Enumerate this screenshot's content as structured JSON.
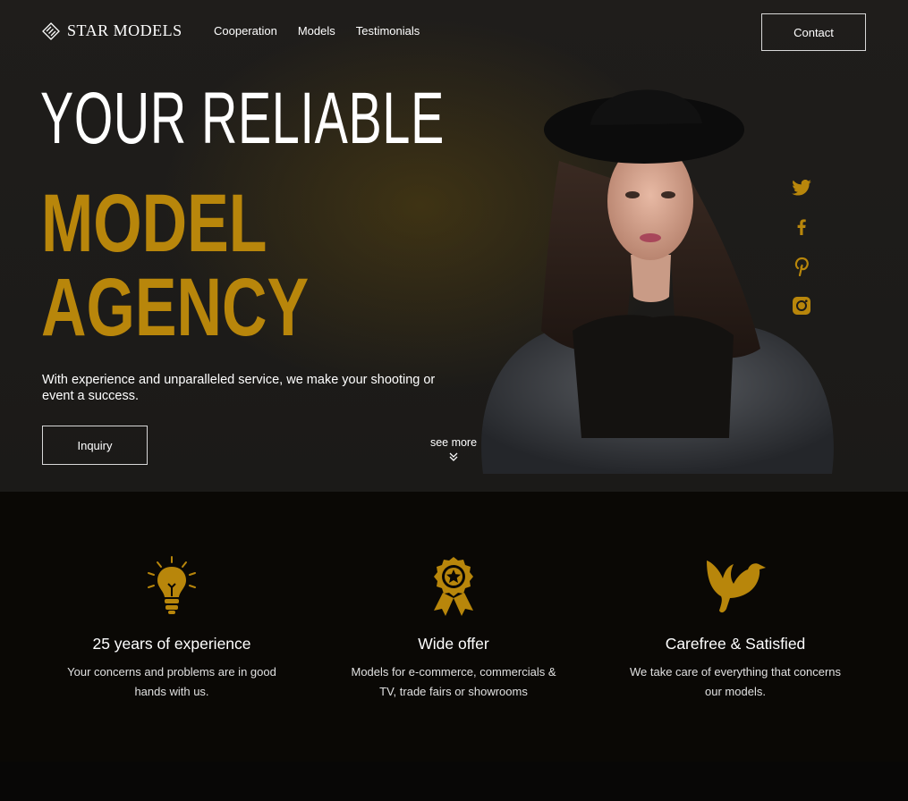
{
  "brand": {
    "name": "STAR MODELS",
    "accent": "#b8860b"
  },
  "nav": {
    "items": [
      "Cooperation",
      "Models",
      "Testimonials"
    ]
  },
  "header": {
    "contact_label": "Contact"
  },
  "hero": {
    "line1": "YOUR RELIABLE",
    "line2": "MODEL",
    "line3": "AGENCY",
    "subtitle": "With experience and unparalleled service, we make your shooting or event a success.",
    "inquiry_label": "Inquiry",
    "see_more_label": "see more"
  },
  "social": [
    "twitter-icon",
    "facebook-icon",
    "pinterest-icon",
    "instagram-icon"
  ],
  "features": [
    {
      "icon": "lightbulb-icon",
      "title": "25 years of experience",
      "text": "Your concerns and problems are in good hands with us."
    },
    {
      "icon": "award-badge-icon",
      "title": "Wide offer",
      "text": "Models for e-commerce, commercials & TV, trade fairs or showrooms"
    },
    {
      "icon": "dove-icon",
      "title": "Carefree & Satisfied",
      "text": "We take care of everything that concerns our models."
    }
  ]
}
